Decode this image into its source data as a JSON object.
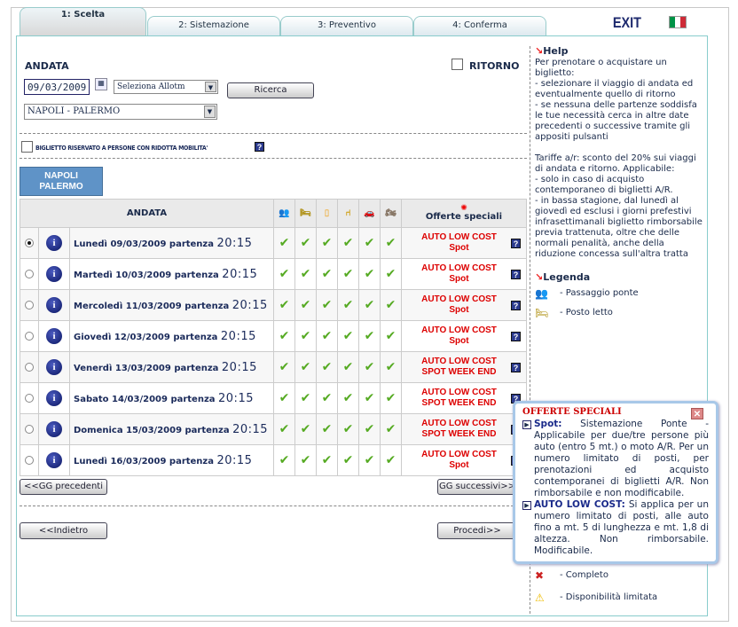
{
  "tabs": [
    {
      "label": "1: Scelta",
      "active": true
    },
    {
      "label": "2: Sistemazione"
    },
    {
      "label": "3: Preventivo"
    },
    {
      "label": "4: Conferma"
    }
  ],
  "exit_label": "EXIT",
  "flag_colors": [
    "#009246",
    "#ffffff",
    "#ce2b37"
  ],
  "form": {
    "andata_label": "ANDATA",
    "ritorno_label": "RITORNO",
    "date": "09/03/2009",
    "allotment": "Seleziona Allotm",
    "search_label": "Ricerca",
    "route": "NAPOLI - PALERMO",
    "reduced_mobility": "BIGLIETTO RISERVATO A PERSONE CON RIDOTTA MOBILITA'"
  },
  "route_tab": {
    "line1": "NAPOLI",
    "line2": "PALERMO"
  },
  "table": {
    "header": "ANDATA",
    "offers_header": "Offerte speciali",
    "accommodation_icons": [
      "deck-passage-icon",
      "bed-icon",
      "cabin-door-icon",
      "seat-icon",
      "car-icon",
      "motorbike-icon"
    ],
    "rows": [
      {
        "day": "Lunedì 09/03/2009 partenza",
        "time": "20:15",
        "selected": true,
        "offer1": "AUTO LOW COST",
        "offer2": "Spot"
      },
      {
        "day": "Martedì 10/03/2009 partenza",
        "time": "20:15",
        "offer1": "AUTO LOW COST",
        "offer2": "Spot"
      },
      {
        "day": "Mercoledì 11/03/2009 partenza",
        "time": "20:15",
        "offer1": "AUTO LOW COST",
        "offer2": "Spot"
      },
      {
        "day": "Giovedì 12/03/2009 partenza",
        "time": "20:15",
        "offer1": "AUTO LOW COST",
        "offer2": "Spot"
      },
      {
        "day": "Venerdì 13/03/2009 partenza",
        "time": "20:15",
        "offer1": "AUTO LOW COST",
        "offer2": "SPOT WEEK END"
      },
      {
        "day": "Sabato 14/03/2009 partenza",
        "time": "20:15",
        "offer1": "AUTO LOW COST",
        "offer2": "SPOT WEEK END"
      },
      {
        "day": "Domenica 15/03/2009 partenza",
        "time": "20:15",
        "offer1": "AUTO LOW COST",
        "offer2": "SPOT WEEK END"
      },
      {
        "day": "Lunedì 16/03/2009 partenza",
        "time": "20:15",
        "offer1": "AUTO LOW COST",
        "offer2": "Spot"
      }
    ]
  },
  "nav": {
    "prev_days": "<<GG precedenti",
    "next_days": "GG successivi>>",
    "back": "<<Indietro",
    "proceed": "Procedi>>"
  },
  "help": {
    "title": "Help",
    "text1": "Per prenotare o acquistare un biglietto:\n- selezionare il viaggio di andata ed eventualmente quello di ritorno\n- se nessuna delle partenze soddisfa le tue necessità cerca in altre date precedenti o successive tramite gli appositi pulsanti",
    "text2": "Tariffe a/r: sconto del 20% sui viaggi di andata e ritorno. Applicabile:\n- solo in caso di acquisto contemporaneo di biglietti A/R.\n- in bassa stagione, dal lunedì al giovedì ed esclusi i giorni prefestivi infrasettimanali biglietto rimborsabile previa trattenuta, oltre che delle normali penalità, anche della riduzione concessa sull'altra tratta",
    "legend_title": "Legenda",
    "legend": [
      "- Passaggio ponte",
      "- Posto letto",
      "- Completo",
      "- Disponibilità limitata"
    ]
  },
  "popup": {
    "title": "OFFERTE SPECIALI",
    "spot_term": "Spot:",
    "spot_text": " Sistemazione Ponte - Applicabile per due/tre persone più auto (entro 5 mt.) o moto A/R. Per un numero limitato di posti, per prenotazioni ed acquisto contemporanei di biglietti A/R. Non rimborsabile e non modificabile.",
    "alc_term": "AUTO LOW COST:",
    "alc_text": " Si applica per un numero limitato di posti, alle auto fino a mt. 5 di lunghezza e mt. 1,8 di altezza. Non rimborsabile. Modificabile."
  }
}
